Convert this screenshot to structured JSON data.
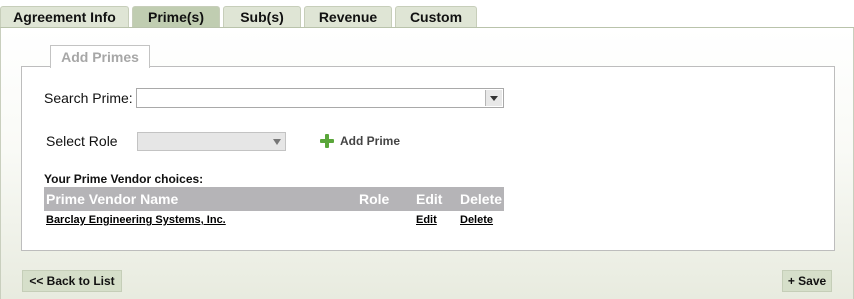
{
  "tabs": [
    {
      "label": "Agreement Info",
      "active": false
    },
    {
      "label": "Prime(s)",
      "active": true
    },
    {
      "label": "Sub(s)",
      "active": false
    },
    {
      "label": "Revenue",
      "active": false
    },
    {
      "label": "Custom",
      "active": false
    }
  ],
  "panel": {
    "legend": "Add Primes",
    "search_label": "Search Prime:",
    "search_value": "",
    "role_label": "Select Role",
    "role_value": "",
    "add_prime_label": "Add Prime"
  },
  "choices": {
    "title": "Your Prime Vendor choices:",
    "columns": [
      "Prime Vendor Name",
      "Role",
      "Edit",
      "Delete"
    ],
    "rows": [
      {
        "name": "Barclay Engineering Systems, Inc.",
        "role": "",
        "edit": "Edit",
        "delete": "Delete"
      }
    ]
  },
  "footer": {
    "back_label": "<< Back to List",
    "save_label": "+ Save"
  },
  "colors": {
    "tab_bg": "#dfe5d5",
    "tab_active_bg": "#c0cdb1",
    "table_header_bg": "#b5b4b7",
    "add_icon": "#5aa63a"
  },
  "icons": {
    "add": "plus-icon",
    "dropdown": "chevron-down-icon"
  }
}
